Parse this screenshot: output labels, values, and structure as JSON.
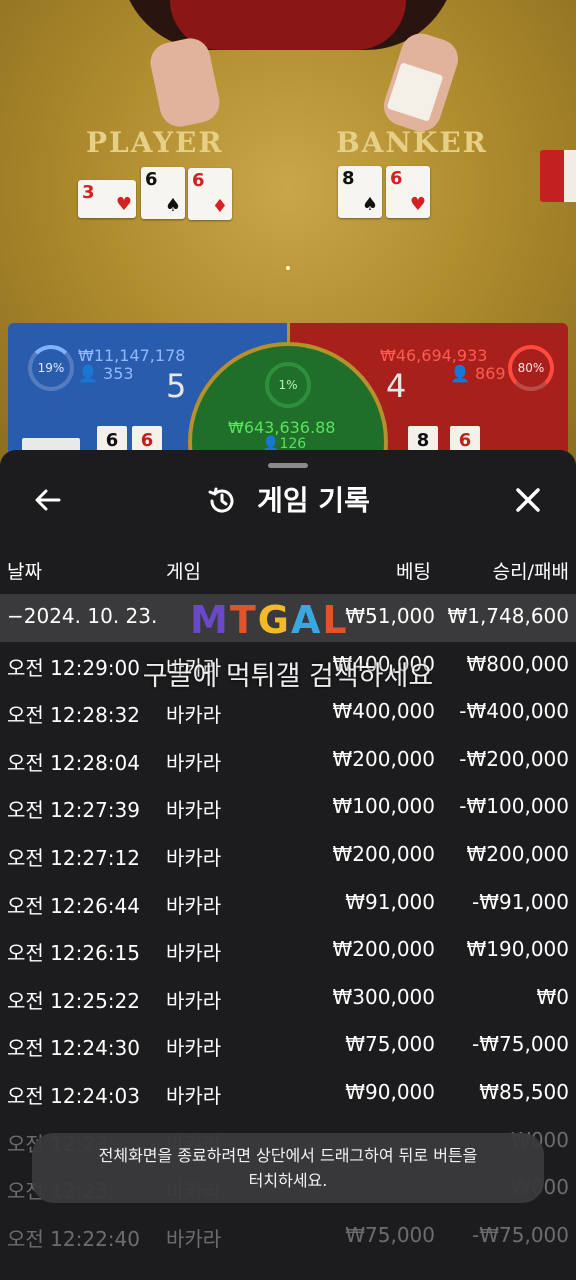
{
  "game_view": {
    "player_label": "PLAYER",
    "banker_label": "BANKER",
    "player_cards": [
      {
        "rank": "3",
        "suit": "♥",
        "color": "red"
      },
      {
        "rank": "6",
        "suit": "♠",
        "color": "black"
      },
      {
        "rank": "6",
        "suit": "♦",
        "color": "red"
      }
    ],
    "banker_cards": [
      {
        "rank": "8",
        "suit": "♠",
        "color": "black"
      },
      {
        "rank": "6",
        "suit": "♥",
        "color": "red"
      }
    ],
    "player_panel": {
      "percent": "19%",
      "amount": "₩11,147,178",
      "count": "353",
      "score": "5"
    },
    "banker_panel": {
      "percent": "80%",
      "amount": "₩46,694,933",
      "count": "869",
      "score": "4"
    },
    "tie_panel": {
      "percent": "1%",
      "amount": "₩643,636.88",
      "count": "126"
    },
    "mini_cards": [
      "6",
      "6",
      "8",
      "6"
    ]
  },
  "history": {
    "title": "게임 기록",
    "columns": {
      "date": "날짜",
      "game": "게임",
      "bet": "베팅",
      "win_loss": "승리/패배"
    },
    "rows": [
      {
        "date": "−2024. 10. 23.",
        "game": "",
        "bet": "₩51,000",
        "win": "₩1,748,600",
        "highlight": true
      },
      {
        "date": "오전 12:29:00",
        "game": "바카라",
        "bet": "₩400,000",
        "win": "₩800,000"
      },
      {
        "date": "오전 12:28:32",
        "game": "바카라",
        "bet": "₩400,000",
        "win": "-₩400,000"
      },
      {
        "date": "오전 12:28:04",
        "game": "바카라",
        "bet": "₩200,000",
        "win": "-₩200,000"
      },
      {
        "date": "오전 12:27:39",
        "game": "바카라",
        "bet": "₩100,000",
        "win": "-₩100,000"
      },
      {
        "date": "오전 12:27:12",
        "game": "바카라",
        "bet": "₩200,000",
        "win": "₩200,000"
      },
      {
        "date": "오전 12:26:44",
        "game": "바카라",
        "bet": "₩91,000",
        "win": "-₩91,000"
      },
      {
        "date": "오전 12:26:15",
        "game": "바카라",
        "bet": "₩200,000",
        "win": "₩190,000"
      },
      {
        "date": "오전 12:25:22",
        "game": "바카라",
        "bet": "₩300,000",
        "win": "₩0"
      },
      {
        "date": "오전 12:24:30",
        "game": "바카라",
        "bet": "₩75,000",
        "win": "-₩75,000"
      },
      {
        "date": "오전 12:24:03",
        "game": "바카라",
        "bet": "₩90,000",
        "win": "₩85,500"
      },
      {
        "date": "오전 12:23:",
        "game": "바카라",
        "bet": "",
        "win": "₩000"
      },
      {
        "date": "오전 12:23:",
        "game": "바카라",
        "bet": "",
        "win": "₩000"
      },
      {
        "date": "오전 12:22:40",
        "game": "바카라",
        "bet": "₩75,000",
        "win": "-₩75,000"
      }
    ]
  },
  "watermark": {
    "logo": [
      "M",
      "T",
      "G",
      "A",
      "L"
    ],
    "text": "구글에 먹튀갤 검색하세요"
  },
  "toast": {
    "line1": "전체화면을 종료하려면 상단에서 드래그하여 뒤로 버튼을",
    "line2": "터치하세요."
  },
  "icons": {
    "back": "arrow-left-icon",
    "history": "history-clock-icon",
    "close": "close-x-icon"
  }
}
